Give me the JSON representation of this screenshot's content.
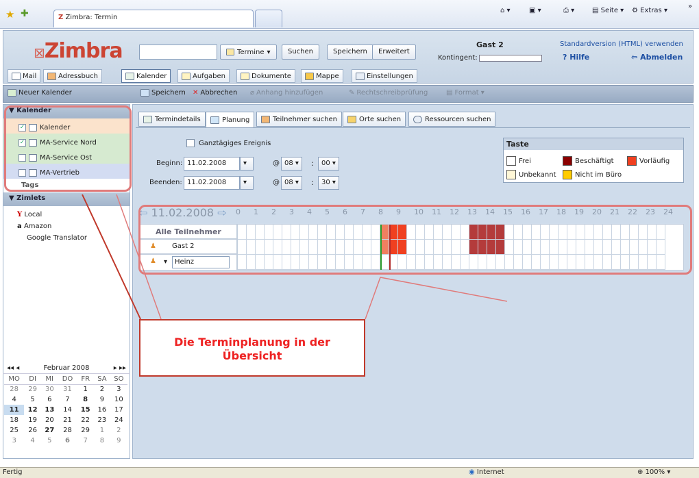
{
  "browser": {
    "tab_title": "Zimbra: Termin",
    "toolbar": [
      "Seite",
      "Extras"
    ]
  },
  "header": {
    "logo": "Zimbra",
    "search_placeholder": "",
    "search_type": "Termine",
    "search_button": "Suchen",
    "save_button": "Speichern",
    "advanced_button": "Erweitert",
    "user": "Gast 2",
    "quota_label": "Kontingent:",
    "html_version_link": "Standardversion (HTML) verwenden",
    "help": "Hilfe",
    "logout": "Abmelden"
  },
  "apptabs": [
    "Mail",
    "Adressbuch",
    "Kalender",
    "Aufgaben",
    "Dokumente",
    "Mappe",
    "Einstellungen"
  ],
  "actions": {
    "new_calendar": "Neuer Kalender",
    "save": "Speichern",
    "cancel": "Abbrechen",
    "attach": "Anhang hinzufügen",
    "spellcheck": "Rechtschreibprüfung",
    "format": "Format"
  },
  "left": {
    "calendars_header": "Kalender",
    "calendars": [
      {
        "label": "Kalender",
        "checked": true,
        "color": "#fbe3cc"
      },
      {
        "label": "MA-Service Nord",
        "checked": true,
        "color": "#d6ead0"
      },
      {
        "label": "MA-Service Ost",
        "checked": false,
        "color": "#d6ead0"
      },
      {
        "label": "MA-Vertrieb",
        "checked": false,
        "color": "#d3dcf2"
      }
    ],
    "tags_header": "Tags",
    "zimlets_header": "Zimlets",
    "zimlets": [
      "Local",
      "Amazon",
      "Google Translator"
    ]
  },
  "mini_cal": {
    "month": "Februar 2008",
    "weekdays": [
      "MO",
      "DI",
      "MI",
      "DO",
      "FR",
      "SA",
      "SO"
    ],
    "weeks": [
      [
        "28",
        "29",
        "30",
        "31",
        "1",
        "2",
        "3"
      ],
      [
        "4",
        "5",
        "6",
        "7",
        "8",
        "9",
        "10"
      ],
      [
        "11",
        "12",
        "13",
        "14",
        "15",
        "16",
        "17"
      ],
      [
        "18",
        "19",
        "20",
        "21",
        "22",
        "23",
        "24"
      ],
      [
        "25",
        "26",
        "27",
        "28",
        "29",
        "1",
        "2"
      ],
      [
        "3",
        "4",
        "5",
        "6",
        "7",
        "8",
        "9"
      ]
    ]
  },
  "tabs": [
    "Termindetails",
    "Planung",
    "Teilnehmer suchen",
    "Orte suchen",
    "Ressourcen suchen"
  ],
  "form": {
    "allday_label": "Ganztägiges Ereignis",
    "begin_label": "Beginn:",
    "begin_date": "11.02.2008",
    "begin_hour": "08",
    "begin_min": "00",
    "end_label": "Beenden:",
    "end_date": "11.02.2008",
    "end_hour": "08",
    "end_min": "30",
    "at": "@"
  },
  "legend": {
    "title": "Taste",
    "items": [
      {
        "label": "Frei",
        "color": "#ffffff"
      },
      {
        "label": "Beschäftigt",
        "color": "#8b0000"
      },
      {
        "label": "Vorläufig",
        "color": "#f04020"
      },
      {
        "label": "Unbekannt",
        "color": "#fff7d6"
      },
      {
        "label": "Nicht im Büro",
        "color": "#ffcc00"
      }
    ]
  },
  "schedule": {
    "date": "11.02.2008",
    "hours": [
      "0",
      "1",
      "2",
      "3",
      "4",
      "5",
      "6",
      "7",
      "8",
      "9",
      "10",
      "11",
      "12",
      "13",
      "14",
      "15",
      "16",
      "17",
      "18",
      "19",
      "20",
      "21",
      "22",
      "23",
      "24"
    ],
    "all_label": "Alle Teilnehmer",
    "attendees": [
      "Gast 2",
      "Heinz"
    ]
  },
  "callout": "Die Terminplanung in der Übersicht",
  "status": {
    "left": "Fertig",
    "zone": "Internet",
    "zoom": "100%"
  }
}
